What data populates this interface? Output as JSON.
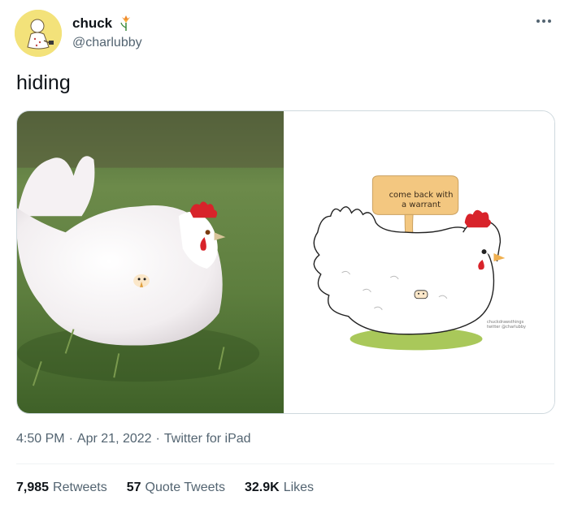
{
  "author": {
    "display_name": "chuck",
    "handle": "@charlubby",
    "avatar_icon": "cartoon-person-avatar",
    "name_emoji_icon": "flower-icon"
  },
  "more_icon": "more-horizontal-icon",
  "tweet": {
    "text": "hiding"
  },
  "media": {
    "photo_alt_icon": "white-hen-photo",
    "drawing": {
      "speech_bubble_text": "come back with a warrant",
      "watermark": "chuckdrawsthings\ntwitter @charlubby"
    }
  },
  "meta": {
    "time": "4:50 PM",
    "separator": "·",
    "date": "Apr 21, 2022",
    "source": "Twitter for iPad"
  },
  "stats": {
    "retweets_count": "7,985",
    "retweets_label": "Retweets",
    "quotes_count": "57",
    "quotes_label": "Quote Tweets",
    "likes_count": "32.9K",
    "likes_label": "Likes"
  },
  "colors": {
    "text_primary": "#0f1419",
    "text_secondary": "#536471",
    "border": "#cfd9de",
    "avatar_bg": "#f3e27a"
  }
}
